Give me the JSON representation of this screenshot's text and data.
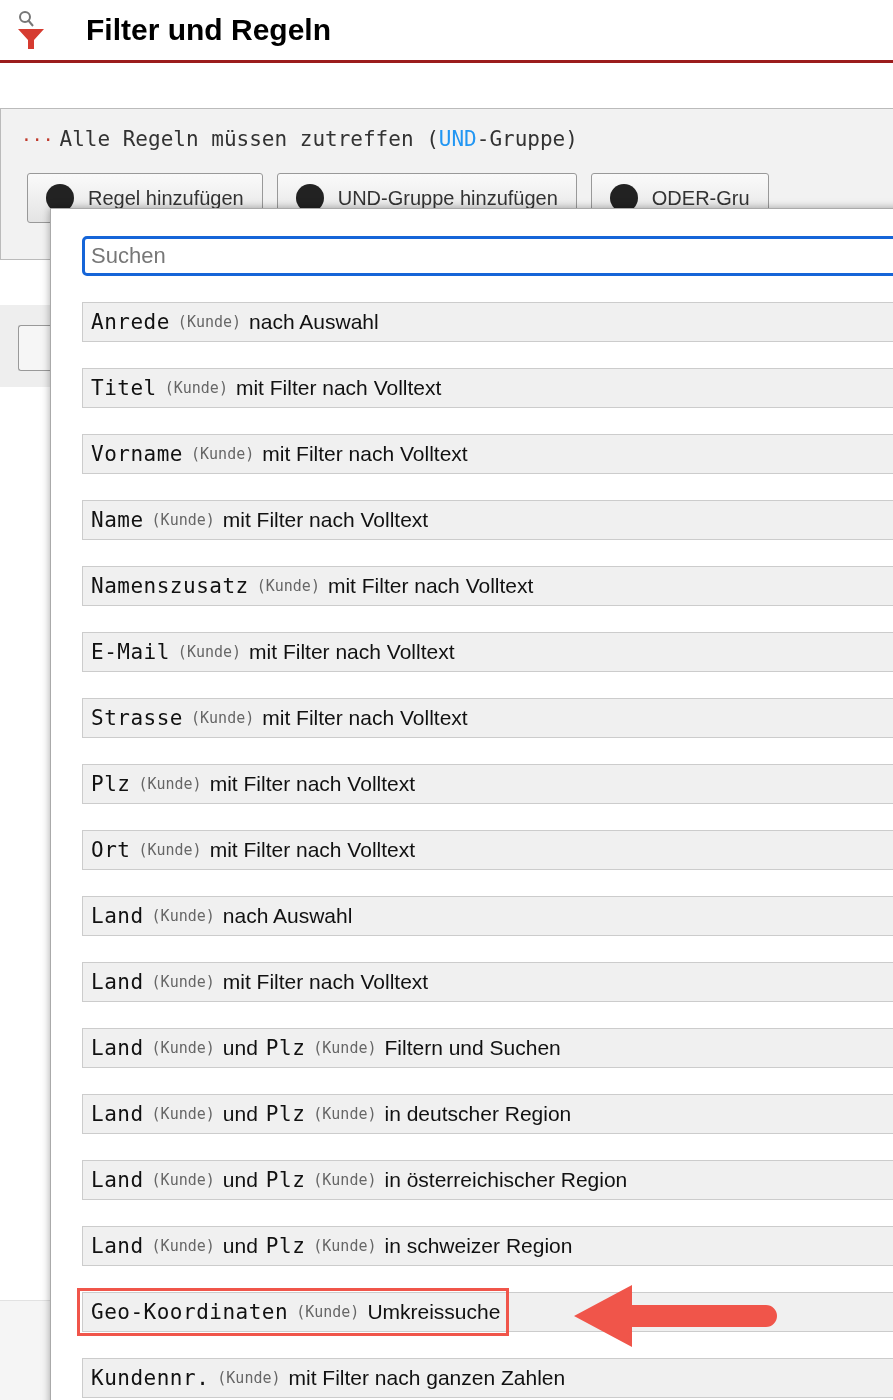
{
  "header": {
    "title": "Filter und Regeln"
  },
  "group": {
    "dots": "···",
    "text_before": "Alle Regeln müssen zutreffen (",
    "operator": "UND",
    "text_after": "-Gruppe)"
  },
  "buttons": [
    {
      "label": "Regel hinzufügen"
    },
    {
      "label": "UND-Gruppe hinzufügen"
    },
    {
      "label": "ODER-Gru"
    }
  ],
  "dropdown": {
    "search": {
      "placeholder": "Suchen"
    },
    "items": [
      {
        "fields": [
          {
            "name": "Anrede",
            "source": "(Kunde)"
          }
        ],
        "description": "nach Auswahl",
        "highlighted": false
      },
      {
        "fields": [
          {
            "name": "Titel",
            "source": "(Kunde)"
          }
        ],
        "description": "mit Filter nach Volltext",
        "highlighted": false
      },
      {
        "fields": [
          {
            "name": "Vorname",
            "source": "(Kunde)"
          }
        ],
        "description": "mit Filter nach Volltext",
        "highlighted": false
      },
      {
        "fields": [
          {
            "name": "Name",
            "source": "(Kunde)"
          }
        ],
        "description": "mit Filter nach Volltext",
        "highlighted": false
      },
      {
        "fields": [
          {
            "name": "Namenszusatz",
            "source": "(Kunde)"
          }
        ],
        "description": "mit Filter nach Volltext",
        "highlighted": false
      },
      {
        "fields": [
          {
            "name": "E-Mail",
            "source": "(Kunde)"
          }
        ],
        "description": "mit Filter nach Volltext",
        "highlighted": false
      },
      {
        "fields": [
          {
            "name": "Strasse",
            "source": "(Kunde)"
          }
        ],
        "description": "mit Filter nach Volltext",
        "highlighted": false
      },
      {
        "fields": [
          {
            "name": "Plz",
            "source": "(Kunde)"
          }
        ],
        "description": "mit Filter nach Volltext",
        "highlighted": false
      },
      {
        "fields": [
          {
            "name": "Ort",
            "source": "(Kunde)"
          }
        ],
        "description": "mit Filter nach Volltext",
        "highlighted": false
      },
      {
        "fields": [
          {
            "name": "Land",
            "source": "(Kunde)"
          }
        ],
        "description": "nach Auswahl",
        "highlighted": false
      },
      {
        "fields": [
          {
            "name": "Land",
            "source": "(Kunde)"
          }
        ],
        "description": "mit Filter nach Volltext",
        "highlighted": false
      },
      {
        "fields": [
          {
            "name": "Land",
            "source": "(Kunde)"
          },
          {
            "name": "Plz",
            "source": "(Kunde)",
            "joiner": "und"
          }
        ],
        "description": "Filtern und Suchen",
        "highlighted": false
      },
      {
        "fields": [
          {
            "name": "Land",
            "source": "(Kunde)"
          },
          {
            "name": "Plz",
            "source": "(Kunde)",
            "joiner": "und"
          }
        ],
        "description": "in deutscher Region",
        "highlighted": false
      },
      {
        "fields": [
          {
            "name": "Land",
            "source": "(Kunde)"
          },
          {
            "name": "Plz",
            "source": "(Kunde)",
            "joiner": "und"
          }
        ],
        "description": "in österreichischer Region",
        "highlighted": false
      },
      {
        "fields": [
          {
            "name": "Land",
            "source": "(Kunde)"
          },
          {
            "name": "Plz",
            "source": "(Kunde)",
            "joiner": "und"
          }
        ],
        "description": "in schweizer Region",
        "highlighted": false
      },
      {
        "fields": [
          {
            "name": "Geo-Koordinaten",
            "source": "(Kunde)"
          }
        ],
        "description": "Umkreissuche",
        "highlighted": true
      },
      {
        "fields": [
          {
            "name": "Kundennr.",
            "source": "(Kunde)"
          }
        ],
        "description": "mit Filter nach ganzen Zahlen",
        "highlighted": false
      }
    ]
  }
}
